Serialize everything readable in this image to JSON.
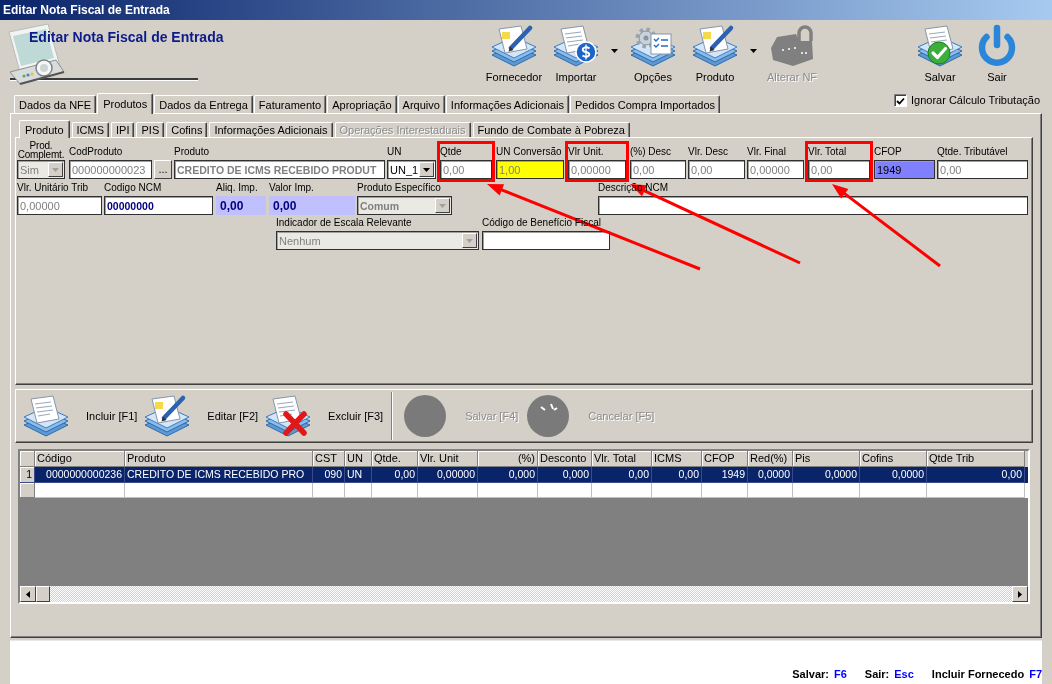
{
  "window": {
    "title": "Editar Nota Fiscal de Entrada"
  },
  "header": {
    "title": "Editar Nota Fiscal de Entrada"
  },
  "toolbar": [
    {
      "label": "Fornecedor",
      "kind": "edit",
      "dropdown": false,
      "disabled": false
    },
    {
      "label": "Importar",
      "kind": "import",
      "dropdown": true,
      "disabled": false
    },
    {
      "label": "Opções",
      "kind": "options",
      "dropdown": false,
      "disabled": false
    },
    {
      "label": "Produto",
      "kind": "edit",
      "dropdown": true,
      "disabled": false
    },
    {
      "label": "Alterar NF",
      "kind": "lock",
      "dropdown": false,
      "disabled": true
    }
  ],
  "window_actions": [
    {
      "label": "Salvar",
      "kind": "save"
    },
    {
      "label": "Sair",
      "kind": "exit"
    }
  ],
  "tabs": [
    {
      "label": "Dados da NFE",
      "selected": false
    },
    {
      "label": "Produtos",
      "selected": true
    },
    {
      "label": "Dados da Entrega",
      "selected": false
    },
    {
      "label": "Faturamento",
      "selected": false
    },
    {
      "label": "Apropriação",
      "selected": false
    },
    {
      "label": "Arquivo",
      "selected": false
    },
    {
      "label": "Informações Adicionais",
      "selected": false
    },
    {
      "label": "Pedidos Compra Importados",
      "selected": false
    }
  ],
  "ignore_tax_calc": {
    "label": "Ignorar Cálculo Tributação",
    "checked": true
  },
  "product_tabs": [
    {
      "label": "Produto",
      "selected": true,
      "disabled": false
    },
    {
      "label": "ICMS",
      "selected": false,
      "disabled": false
    },
    {
      "label": "IPI",
      "selected": false,
      "disabled": false
    },
    {
      "label": "PIS",
      "selected": false,
      "disabled": false
    },
    {
      "label": "Cofins",
      "selected": false,
      "disabled": false
    },
    {
      "label": "Informações Adicionais",
      "selected": false,
      "disabled": false
    },
    {
      "label": "Operações Interestaduais",
      "selected": false,
      "disabled": true
    },
    {
      "label": "Fundo de Combate à Pobreza",
      "selected": false,
      "disabled": false
    }
  ],
  "product_form": {
    "fields": [
      {
        "label": "Prod. Complemt.",
        "value": "Sim",
        "kind": "select",
        "disabled": true,
        "bold": false,
        "highlighted": false
      },
      {
        "label": "CodProduto",
        "value": "000000000023",
        "kind": "lookup",
        "button": "...",
        "disabled": true,
        "bold": false,
        "highlighted": false
      },
      {
        "label": "Produto",
        "value": "CREDITO DE ICMS RECEBIDO PRODUT",
        "kind": "text",
        "disabled": true,
        "bold": true,
        "highlighted": false
      },
      {
        "label": "UN",
        "value": "UN_1",
        "kind": "select",
        "disabled": false,
        "bold": false,
        "highlighted": false
      },
      {
        "label": "Qtde",
        "value": "0,00",
        "kind": "text",
        "disabled": true,
        "bold": false,
        "highlighted": true
      },
      {
        "label": "UN Conversão",
        "value": "1,00",
        "kind": "text",
        "color": "#ffff00",
        "disabled": true,
        "bold": false,
        "highlighted": false
      },
      {
        "label": "Vlr Unit.",
        "value": "0,00000",
        "kind": "text",
        "disabled": true,
        "bold": false,
        "highlighted": true
      },
      {
        "label": "(%) Desc",
        "value": "0,00",
        "kind": "text",
        "disabled": true,
        "bold": false,
        "highlighted": false
      },
      {
        "label": "Vlr. Desc",
        "value": "0,00",
        "kind": "text",
        "disabled": true,
        "bold": false,
        "highlighted": false
      },
      {
        "label": "Vlr. Final",
        "value": "0,00000",
        "kind": "text",
        "disabled": true,
        "bold": false,
        "highlighted": false
      },
      {
        "label": "Vlr. Total",
        "value": "0,00",
        "kind": "text",
        "disabled": true,
        "bold": false,
        "highlighted": true
      },
      {
        "label": "CFOP",
        "value": "1949",
        "kind": "text",
        "color": "#8080ff",
        "disabled": false,
        "bold": false,
        "highlighted": false
      },
      {
        "label": "Qtde. Tributável",
        "value": "0,00",
        "kind": "text",
        "disabled": true,
        "bold": false,
        "highlighted": false
      },
      {
        "label": "Vlr. Unitário Trib",
        "value": "0,00000",
        "kind": "text",
        "disabled": true,
        "bold": false,
        "highlighted": false
      },
      {
        "label": "Codigo NCM",
        "value": "00000000",
        "kind": "text",
        "disabled": false,
        "bold": true,
        "highlighted": false
      },
      {
        "label": "Aliq. Imp.",
        "value": "0,00",
        "kind": "display",
        "color": "#c0c0ff",
        "disabled": false,
        "bold": true,
        "highlighted": false
      },
      {
        "label": "Valor Imp.",
        "value": "0,00",
        "kind": "display",
        "color": "#c0c0ff",
        "disabled": false,
        "bold": true,
        "highlighted": false
      },
      {
        "label": "Produto Específico",
        "value": "Comum",
        "kind": "select",
        "disabled": true,
        "bold": true,
        "highlighted": false
      },
      {
        "label": "Descrição NCM",
        "kind": "text",
        "highlighted": false
      },
      {
        "label": "Indicador de Escala Relevante",
        "value": "Nenhum",
        "kind": "select",
        "disabled": true,
        "bold": false,
        "highlighted": false
      },
      {
        "label": "Código de Benefício Fiscal",
        "kind": "text",
        "highlighted": false
      }
    ]
  },
  "item_actions": [
    {
      "items": [
        {
          "label": "Incluir [F1]",
          "kind": "add",
          "disabled": false
        },
        {
          "label": "Editar [F2]",
          "kind": "edit",
          "disabled": false
        },
        {
          "label": "Excluir [F3]",
          "kind": "delete",
          "disabled": false
        }
      ]
    },
    {
      "items": [
        {
          "label": "Salvar [F4]",
          "kind": "save",
          "disabled": true
        },
        {
          "label": "Cancelar [F5]",
          "kind": "cancel",
          "disabled": true
        }
      ]
    }
  ],
  "items_table": {
    "columns": [
      "Código",
      "Produto",
      "CST",
      "UN",
      "Qtde.",
      "Vlr. Unit",
      "(%)",
      "Desconto",
      "Vlr. Total",
      "ICMS",
      "CFOP",
      "Red(%)",
      "Pis",
      "Cofins",
      "Qtde Trib"
    ],
    "rows": [
      {
        "number": "1",
        "selected": true,
        "cells": [
          "0000000000236",
          "CREDITO DE ICMS RECEBIDO PRO",
          "090",
          "UN",
          "0,00",
          "0,00000",
          "0,000",
          "0,000",
          "0,00",
          "0,00",
          "1949",
          "0,0000",
          "0,0000",
          "0,0000",
          "0,00"
        ]
      }
    ]
  },
  "status_bar": [
    {
      "label": "Salvar:",
      "key": "F6"
    },
    {
      "label": "Sair:",
      "key": "Esc"
    },
    {
      "label": "Incluir Fornecedo",
      "key": "F7"
    }
  ]
}
